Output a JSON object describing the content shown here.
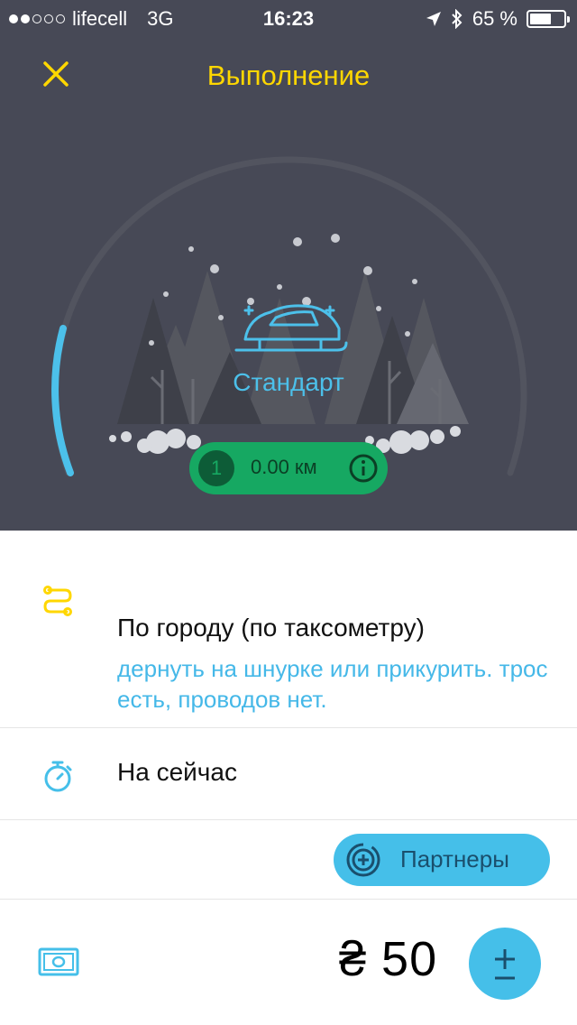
{
  "status_bar": {
    "carrier": "lifecell",
    "network": "3G",
    "time": "16:23",
    "battery": "65 %",
    "battery_level": 0.65,
    "signal_dots_filled": 2,
    "signal_dots_total": 5
  },
  "header": {
    "title": "Выполнение",
    "close_icon": "close-icon"
  },
  "tariff": {
    "name": "Стандарт",
    "icon": "car-on-sled-icon",
    "progress": 0.1
  },
  "distance_pill": {
    "stop_number": "1",
    "distance": "0.00 км",
    "info_icon": "info-icon"
  },
  "route": {
    "icon": "route-icon",
    "title": "По городу (по таксометру)",
    "comment": "дернуть на шнурке или прикурить. трос есть, проводов нет."
  },
  "time": {
    "icon": "stopwatch-icon",
    "label": "На сейчас"
  },
  "partners_button": {
    "label": "Партнеры",
    "icon": "partners-icon"
  },
  "price": {
    "icon": "cash-icon",
    "value": "₴ 50",
    "adjust_icon": "plus-minus-icon"
  },
  "colors": {
    "header_bg": "#474956",
    "accent_yellow": "#ffd700",
    "accent_blue": "#45bfe9",
    "pill_green": "#16a862"
  }
}
